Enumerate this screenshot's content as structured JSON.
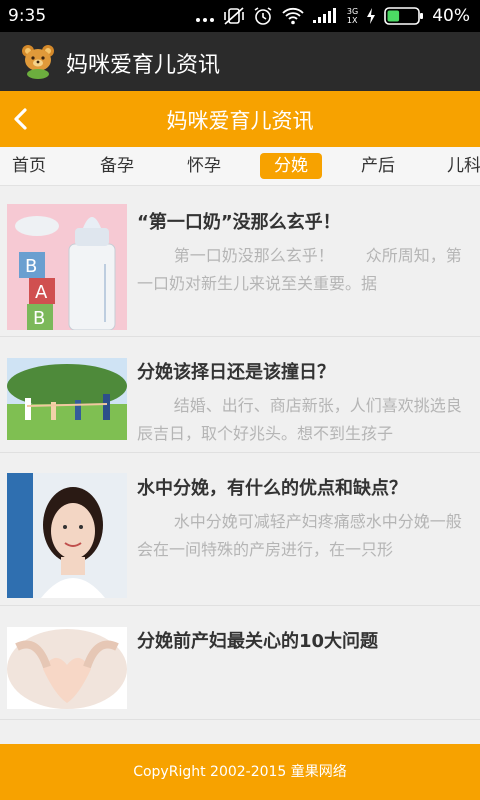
{
  "status_bar": {
    "time": "9:35",
    "network": "3G",
    "network_sub": "1X",
    "battery": "40%",
    "battery_level": 0.4
  },
  "app_bar": {
    "title": "妈咪爱育儿资讯",
    "logo_icon": "teddy-bear-icon"
  },
  "title_bar": {
    "title": "妈咪爱育儿资讯",
    "back_icon": "chevron-left-icon"
  },
  "tabs": [
    {
      "label": "首页",
      "active": false
    },
    {
      "label": "备孕",
      "active": false
    },
    {
      "label": "怀孕",
      "active": false
    },
    {
      "label": "分娩",
      "active": true
    },
    {
      "label": "产后",
      "active": false
    },
    {
      "label": "儿科",
      "active": false
    }
  ],
  "articles": [
    {
      "title": "“第一口奶”没那么玄乎！",
      "summary": "第一口奶没那么玄乎！　　众所周知，第一口奶对新生儿来说至关重要。据"
    },
    {
      "title": "分娩该择日还是该撞日？",
      "summary": "结婚、出行、商店新张，人们喜欢挑选良辰吉日，取个好兆头。想不到生孩子"
    },
    {
      "title": "水中分娩，有什么的优点和缺点？",
      "summary": "水中分娩可减轻产妇疼痛感水中分娩一般会在一间特殊的产房进行，在一只形"
    },
    {
      "title": "分娩前产妇最关心的10大问题",
      "summary": ""
    }
  ],
  "footer": {
    "copyright": "CopyRight 2002-2015 童果网络"
  },
  "colors": {
    "accent": "#f7a200",
    "app_bar": "#2b2b2b",
    "status_bar": "#000000",
    "title_text": "#333333",
    "summary_text": "#b5b5b5"
  }
}
